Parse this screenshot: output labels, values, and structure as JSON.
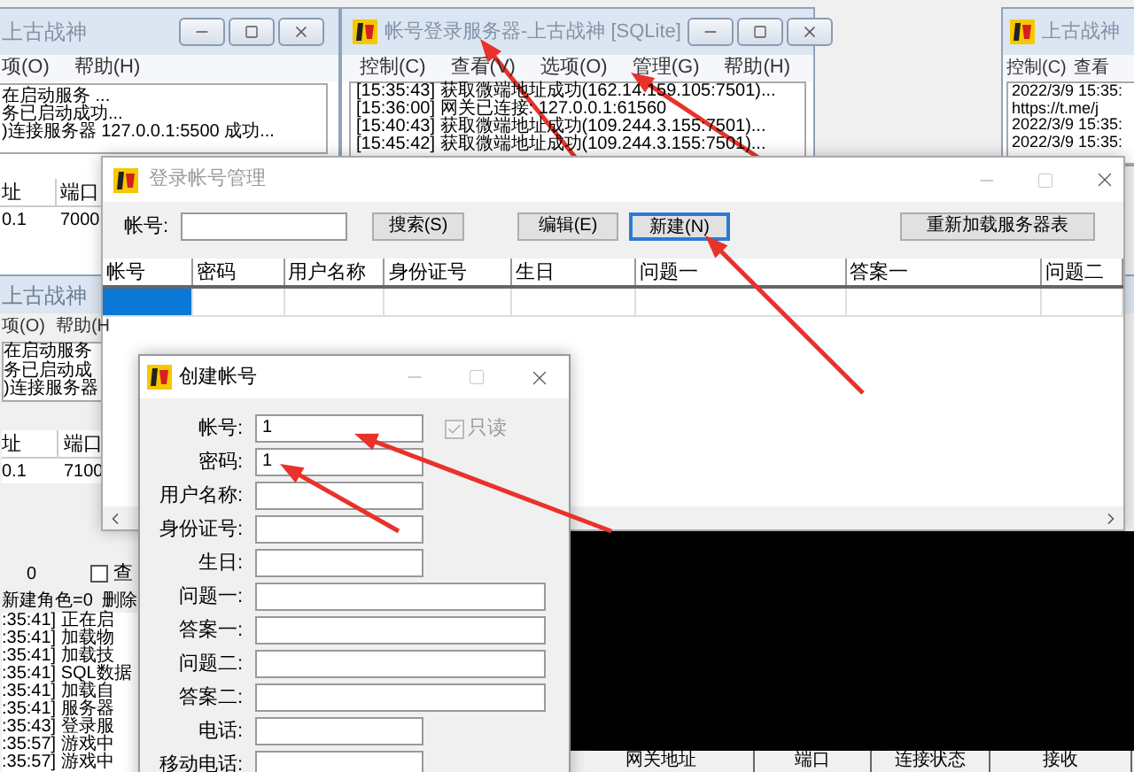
{
  "back_window": {
    "title": "上古战神",
    "menu": [
      "项(O)",
      "帮助(H)"
    ],
    "log": [
      "在启动服务 ...",
      "务已启动成功...",
      ")连接服务器 127.0.0.1:5500 成功..."
    ],
    "columns": [
      "址",
      "端口"
    ],
    "row": [
      "0.1",
      "7000"
    ]
  },
  "server_window": {
    "title": "帐号登录服务器-上古战神 [SQLite]",
    "menu": [
      "控制(C)",
      "查看(V)",
      "选项(O)",
      "管理(G)",
      "帮助(H)"
    ],
    "log": [
      "[15:35:43] 获取微端地址成功(162.14.159.105:7501)...",
      "[15:36:00] 网关已连接: 127.0.0.1:61560",
      "[15:40:43] 获取微端地址成功(109.244.3.155:7501)...",
      "[15:45:42] 获取微端地址成功(109.244.3.155:7501)..."
    ]
  },
  "right_window": {
    "title": "上古战神",
    "menu": [
      "控制(C)",
      "查看"
    ],
    "log": [
      "2022/3/9 15:35:",
      "https://t.me/j",
      "2022/3/9 15:35:",
      "2022/3/9 15:35:"
    ]
  },
  "lower_window": {
    "title": "上古战神",
    "menu": [
      "项(O)",
      "帮助(H"
    ],
    "log": [
      "在启动服务",
      "务已启动成",
      ")连接服务器"
    ],
    "columns": [
      "址",
      "端口"
    ],
    "row": [
      "0.1",
      "7100"
    ],
    "count": "0",
    "filter": {
      "label": "查",
      "checked": false
    },
    "stats": [
      "新建角色=0",
      "删除"
    ],
    "events": [
      ":35:41] 正在启",
      ":35:41] 加载物",
      ":35:41] 加载技",
      ":35:41] SQL数据",
      ":35:41] 加载自",
      ":35:41] 服务器",
      ":35:43] 登录服",
      ":35:57] 游戏中",
      ":35:57] 游戏中"
    ],
    "gateway_columns": [
      "网关地址",
      "端口",
      "连接状态",
      "接收"
    ]
  },
  "login_manager": {
    "title": "登录帐号管理",
    "search_label": "帐号:",
    "buttons": [
      {
        "label": "搜索(S)",
        "focused": false
      },
      {
        "label": "编辑(E)",
        "focused": false
      },
      {
        "label": "新建(N)",
        "focused": true
      },
      {
        "label": "重新加载服务器表",
        "focused": false
      }
    ],
    "columns": [
      "帐号",
      "密码",
      "用户名称",
      "身份证号",
      "生日",
      "问题一",
      "答案一",
      "问题二"
    ],
    "rows": [
      {
        "selected": true
      }
    ]
  },
  "create_dialog": {
    "title": "创建帐号",
    "readonly": {
      "label": "只读",
      "checked": true,
      "disabled": true
    },
    "fields": [
      {
        "label": "帐号:",
        "value": "1",
        "kind": "short"
      },
      {
        "label": "密码:",
        "value": "1",
        "kind": "short"
      },
      {
        "label": "用户名称:",
        "kind": "short"
      },
      {
        "label": "身份证号:",
        "kind": "short"
      },
      {
        "label": "生日:",
        "kind": "short"
      },
      {
        "label": "问题一:",
        "kind": "long"
      },
      {
        "label": "答案一:",
        "kind": "long"
      },
      {
        "label": "问题二:",
        "kind": "long"
      },
      {
        "label": "答案二:",
        "kind": "long"
      },
      {
        "label": "电话:",
        "kind": "short"
      },
      {
        "label": "移动电话:",
        "kind": "short"
      }
    ]
  }
}
